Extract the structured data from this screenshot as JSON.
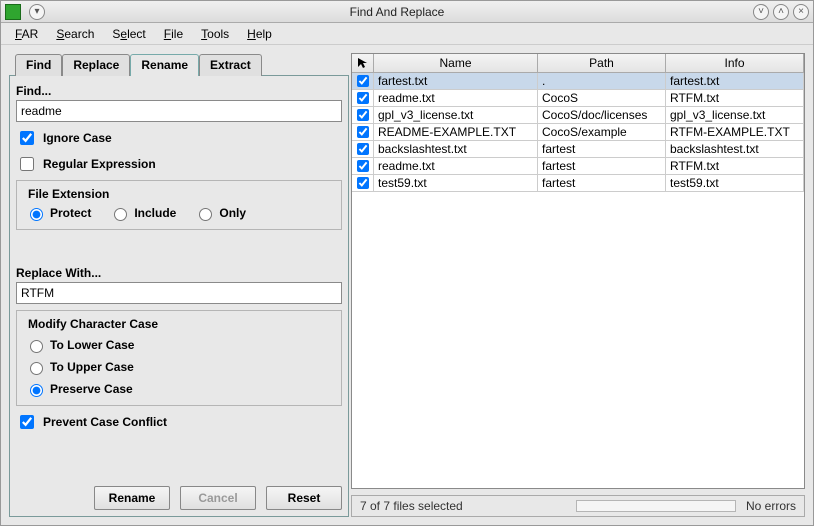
{
  "window": {
    "title": "Find And Replace"
  },
  "menubar": [
    "FAR",
    "Search",
    "Select",
    "File",
    "Tools",
    "Help"
  ],
  "tabs": {
    "items": [
      "Find",
      "Replace",
      "Rename",
      "Extract"
    ],
    "active": 2
  },
  "find": {
    "label": "Find...",
    "value": "readme",
    "ignore_case_label": "Ignore Case",
    "ignore_case": true,
    "regex_label": "Regular Expression",
    "regex": false,
    "file_ext_legend": "File Extension",
    "file_ext_options": [
      "Protect",
      "Include",
      "Only"
    ],
    "file_ext_selected": 0
  },
  "replace": {
    "label": "Replace With...",
    "value": "RTFM",
    "mcc_legend": "Modify Character Case",
    "mcc_options": [
      "To Lower Case",
      "To Upper Case",
      "Preserve Case"
    ],
    "mcc_selected": 2,
    "prevent_conflict_label": "Prevent Case Conflict",
    "prevent_conflict": true
  },
  "buttons": {
    "rename": "Rename",
    "cancel": "Cancel",
    "reset": "Reset"
  },
  "grid": {
    "headers": {
      "name": "Name",
      "path": "Path",
      "info": "Info"
    },
    "rows": [
      {
        "checked": true,
        "selected": true,
        "name": "fartest.txt",
        "path": ".",
        "info": "fartest.txt"
      },
      {
        "checked": true,
        "selected": false,
        "name": "readme.txt",
        "path": "CocoS",
        "info": "RTFM.txt"
      },
      {
        "checked": true,
        "selected": false,
        "name": "gpl_v3_license.txt",
        "path": "CocoS/doc/licenses",
        "info": "gpl_v3_license.txt"
      },
      {
        "checked": true,
        "selected": false,
        "name": "README-EXAMPLE.TXT",
        "path": "CocoS/example",
        "info": "RTFM-EXAMPLE.TXT"
      },
      {
        "checked": true,
        "selected": false,
        "name": "backslashtest.txt",
        "path": "fartest",
        "info": "backslashtest.txt"
      },
      {
        "checked": true,
        "selected": false,
        "name": "readme.txt",
        "path": "fartest",
        "info": "RTFM.txt"
      },
      {
        "checked": true,
        "selected": false,
        "name": "test59.txt",
        "path": "fartest",
        "info": "test59.txt"
      }
    ]
  },
  "status": {
    "left": "7 of 7 files selected",
    "right": "No errors"
  }
}
